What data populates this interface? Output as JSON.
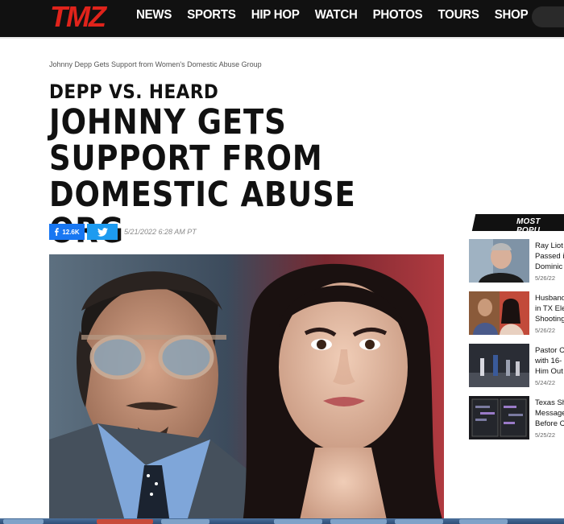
{
  "brand": {
    "name": "TMZ",
    "accent": "#e0231b"
  },
  "nav": {
    "items": [
      "NEWS",
      "SPORTS",
      "HIP HOP",
      "WATCH",
      "PHOTOS",
      "TOURS",
      "SHOP"
    ]
  },
  "article": {
    "breadcrumb": "Johnny Depp Gets Support from Women's Domestic Abuse Group",
    "kicker": "DEPP VS. HEARD",
    "headline_lines": [
      "JOHNNY GETS",
      "SUPPORT FROM",
      "DOMESTIC ABUSE ORG"
    ],
    "share": {
      "facebook_count": "12.6K"
    },
    "date": "5/21/2022 6:28 AM PT"
  },
  "sidebar": {
    "header": "MOST POPU",
    "items": [
      {
        "lines": [
          "Ray Liot",
          "Passed i",
          "Dominic"
        ],
        "date": "5/26/22"
      },
      {
        "lines": [
          "Husband",
          "in TX Ele",
          "Shooting"
        ],
        "date": "5/26/22"
      },
      {
        "lines": [
          "Pastor C",
          "with 16-",
          "Him Out"
        ],
        "date": "5/24/22"
      },
      {
        "lines": [
          "Texas Sh",
          "Message",
          "Before C"
        ],
        "date": "5/25/22"
      }
    ]
  }
}
